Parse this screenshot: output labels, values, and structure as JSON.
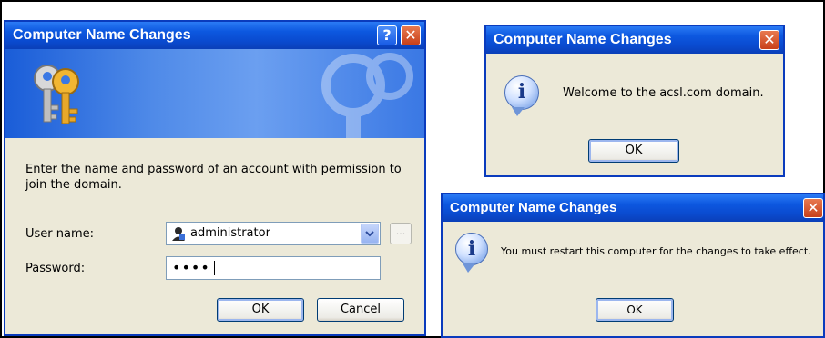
{
  "login_dialog": {
    "title": "Computer Name Changes",
    "help_glyph": "?",
    "close_glyph": "✕",
    "instructions": "Enter the name and password of an account with permission to join the domain.",
    "username_label": "User name:",
    "username_value": "administrator",
    "password_label": "Password:",
    "password_value": "••••",
    "browse_glyph": "...",
    "ok_label": "OK",
    "cancel_label": "Cancel",
    "icons": {
      "banner": "keys-icon",
      "user": "user-icon",
      "dropdown": "chevron-down-icon"
    }
  },
  "welcome_dialog": {
    "title": "Computer Name Changes",
    "close_glyph": "✕",
    "message": "Welcome to the acsl.com domain.",
    "ok_label": "OK",
    "icon": "info-icon",
    "icon_glyph": "i"
  },
  "restart_dialog": {
    "title": "Computer Name Changes",
    "close_glyph": "✕",
    "message": "You must restart this computer for the changes to take effect.",
    "ok_label": "OK",
    "icon": "info-icon",
    "icon_glyph": "i"
  },
  "colors": {
    "titlebar": "#0a4bd0",
    "dialog_bg": "#ece9d8",
    "close": "#c8401a"
  }
}
